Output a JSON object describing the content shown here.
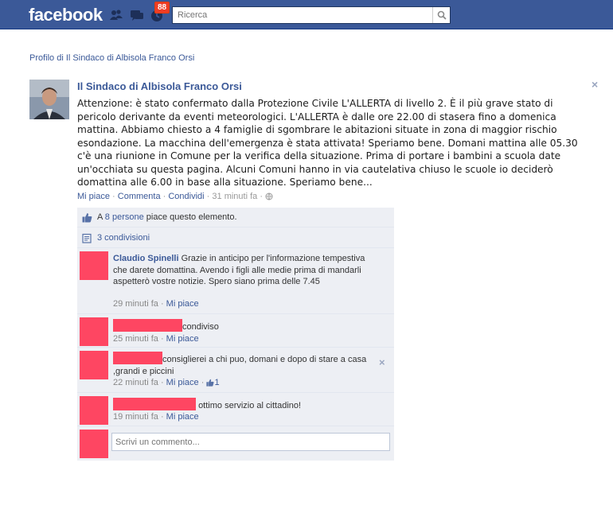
{
  "topbar": {
    "logo": "facebook",
    "notifications_count": "88",
    "search_placeholder": "Ricerca",
    "colors": {
      "bar": "#3b5998",
      "badge": "#f03d25"
    }
  },
  "breadcrumb": "Profilo di Il Sindaco di Albisola Franco Orsi",
  "story": {
    "author": "Il Sindaco di Albisola Franco Orsi",
    "close_label": "×",
    "message": "Attenzione: è stato confermato dalla Protezione Civile L'ALLERTA di livello 2. È il più grave stato di pericolo derivante da eventi meteorologici. L'ALLERTA è dalle ore 22.00 di stasera fino a domenica mattina. Abbiamo chiesto a 4 famiglie di sgombrare le abitazioni situate in zona di maggior rischio esondazione. La macchina dell'emergenza è stata attivata! Speriamo bene. Domani mattina alle 05.30 c'è una riunione in Comune per la verifica della situazione. Prima di portare i bambini a scuola date un'occhiata su questa pagina. Alcuni Comuni hanno in via cautelativa chiuso le scuole io deciderò domattina alle 6.00 in base alla situazione. Speriamo bene...",
    "actions": {
      "like": "Mi piace",
      "comment": "Commenta",
      "share": "Condividi",
      "time": "31 minuti fa",
      "separator": "·"
    }
  },
  "ufi": {
    "likes": {
      "prefix": "A ",
      "link": "8 persone",
      "suffix": " piace questo elemento."
    },
    "shares": {
      "link": "3 condivisioni"
    },
    "comments": [
      {
        "name": "Claudio Spinelli",
        "text": "Grazie in anticipo per l'informazione tempestiva che darete domattina. Avendo i figli alle medie prima di mandarli aspetterò vostre notizie. Spero siano prima delle 7.45",
        "time": "29 minuti fa",
        "like": "Mi piace"
      },
      {
        "text": "condiviso",
        "time": "25 minuti fa",
        "like": "Mi piace"
      },
      {
        "text": "consiglierei a chi puo, domani e dopo di stare a casa ,grandi e piccini",
        "time": "22 minuti fa",
        "like": "Mi piace",
        "like_count": "1",
        "close_label": "×"
      },
      {
        "text": "ottimo servizio al cittadino!",
        "time": "19 minuti fa",
        "like": "Mi piace"
      }
    ],
    "comment_input_placeholder": "Scrivi un commento..."
  }
}
